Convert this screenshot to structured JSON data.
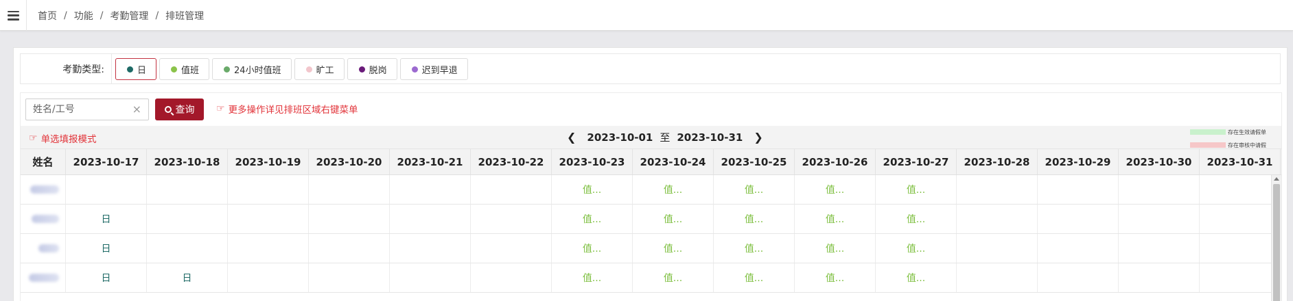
{
  "breadcrumb": [
    "首页",
    "功能",
    "考勤管理",
    "排班管理"
  ],
  "breadcrumb_sep": "/",
  "filter": {
    "label": "考勤类型:",
    "types": [
      {
        "label": "日",
        "color": "#1e6a66",
        "active": true
      },
      {
        "label": "值班",
        "color": "#8bc34a",
        "active": false
      },
      {
        "label": "24小时值班",
        "color": "#6aaa6a",
        "active": false
      },
      {
        "label": "旷工",
        "color": "#f2c6cc",
        "active": false
      },
      {
        "label": "脱岗",
        "color": "#6a1b7a",
        "active": false
      },
      {
        "label": "迟到早退",
        "color": "#9c6ad0",
        "active": false
      }
    ]
  },
  "search": {
    "placeholder": "姓名/工号",
    "value": "",
    "clear": "×",
    "query_label": "查询",
    "tip": "更多操作详见排班区域右键菜单"
  },
  "nav": {
    "single_mode": "单选填报模式",
    "start_date": "2023-10-01",
    "to": "至",
    "end_date": "2023-10-31",
    "prev": "❮",
    "next": "❯"
  },
  "legend": [
    {
      "label": "存在生效请假单",
      "color": "#c9f1cc"
    },
    {
      "label": "存在审核中请假",
      "color": "#f6c7c8"
    }
  ],
  "table": {
    "name_header": "姓名",
    "dates": [
      "2023-10-17",
      "2023-10-18",
      "2023-10-19",
      "2023-10-20",
      "2023-10-21",
      "2023-10-22",
      "2023-10-23",
      "2023-10-24",
      "2023-10-25",
      "2023-10-26",
      "2023-10-27",
      "2023-10-28",
      "2023-10-29",
      "2023-10-30",
      "2023-10-31"
    ],
    "rows": [
      {
        "cells": [
          "",
          "",
          "",
          "",
          "",
          "",
          "值...",
          "值...",
          "值...",
          "值...",
          "值...",
          "",
          "",
          "",
          ""
        ]
      },
      {
        "cells": [
          "日",
          "",
          "",
          "",
          "",
          "",
          "值...",
          "值...",
          "值...",
          "值...",
          "值...",
          "",
          "",
          "",
          ""
        ]
      },
      {
        "cells": [
          "日",
          "",
          "",
          "",
          "",
          "",
          "值...",
          "值...",
          "值...",
          "值...",
          "值...",
          "",
          "",
          "",
          ""
        ]
      },
      {
        "cells": [
          "日",
          "日",
          "",
          "",
          "",
          "",
          "值...",
          "值...",
          "值...",
          "值...",
          "值...",
          "",
          "",
          "",
          ""
        ]
      }
    ]
  }
}
